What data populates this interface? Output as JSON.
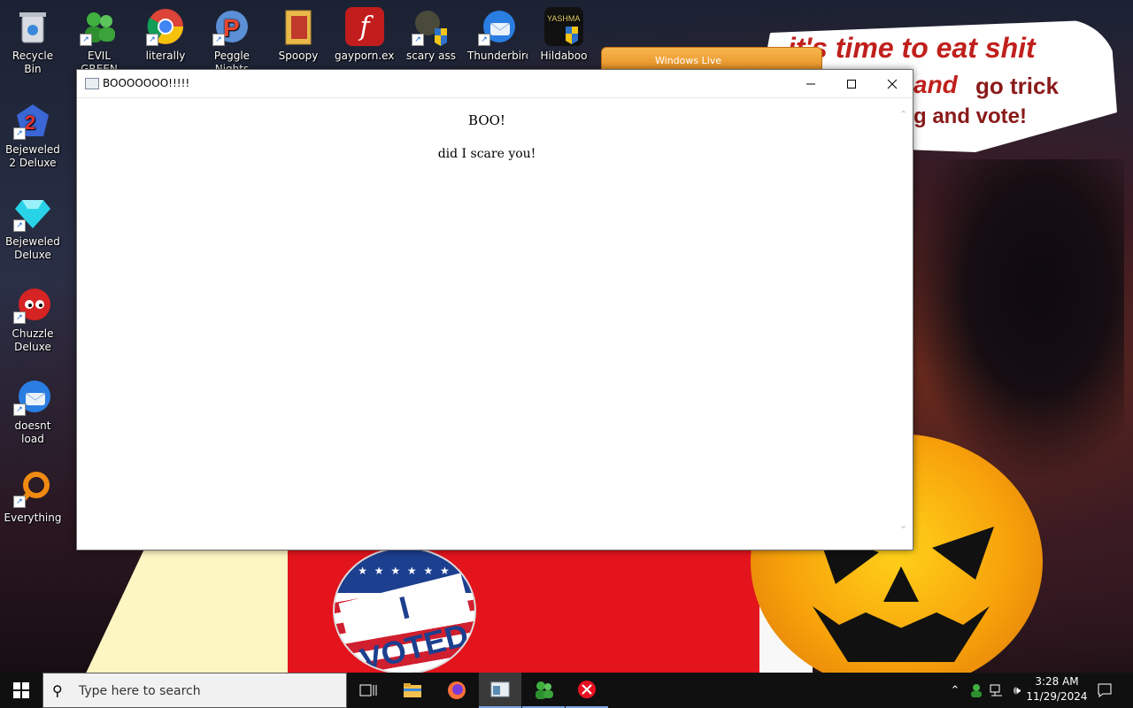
{
  "wallpaper": {
    "speech_line1": "it's time to eat shit",
    "speech_line2a": "and",
    "speech_line2b": "go trick",
    "speech_line3": "g and vote!",
    "badge_text": "I VOTED"
  },
  "desktop": {
    "icons_top": [
      {
        "label": "Recycle Bin",
        "icon": "recycle-bin-icon"
      },
      {
        "label": "EVIL GREEN MEN GO",
        "icon": "green-men-icon"
      },
      {
        "label": "literally",
        "icon": "chrome-icon"
      },
      {
        "label": "Peggle Nights",
        "icon": "peggle-icon"
      },
      {
        "label": "Spoopy",
        "icon": "folder-icon"
      },
      {
        "label": "gayporn.exe",
        "icon": "flash-icon"
      },
      {
        "label": "scary ass",
        "icon": "scary-icon"
      },
      {
        "label": "Thunderbird",
        "icon": "thunderbird-icon"
      },
      {
        "label": "Hildaboo",
        "icon": "yashma-icon"
      }
    ],
    "icons_left": [
      {
        "label": "Bejeweled 2 Deluxe",
        "icon": "bejeweled2-icon"
      },
      {
        "label": "Bejeweled Deluxe",
        "icon": "bejeweled-icon"
      },
      {
        "label": "Chuzzle Deluxe",
        "icon": "chuzzle-icon"
      },
      {
        "label": "doesnt load",
        "icon": "thunderbird-icon"
      },
      {
        "label": "Everything",
        "icon": "everything-icon"
      }
    ],
    "bg_window_title": "Windows Live"
  },
  "window": {
    "title": "BOOOOOOO!!!!!",
    "line1": "BOO!",
    "line2": "did I scare you!"
  },
  "taskbar": {
    "search_placeholder": "Type here to search",
    "time": "3:28 AM",
    "date": "11/29/2024"
  }
}
